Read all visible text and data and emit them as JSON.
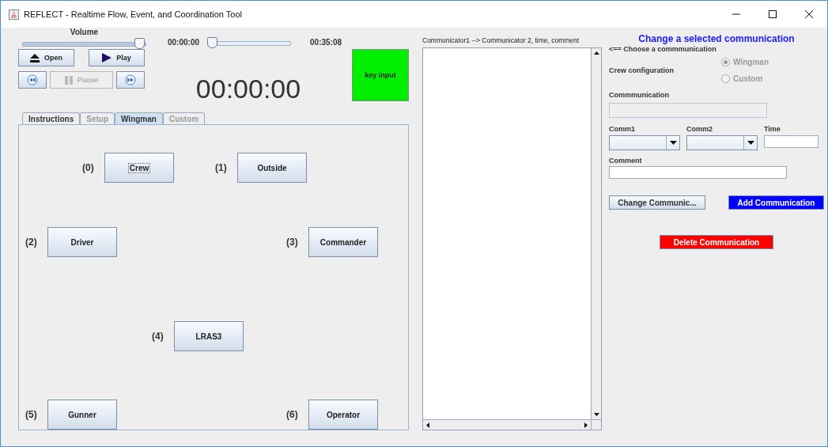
{
  "window": {
    "title": "REFLECT - Realtime Flow, Event, and Coordination Tool"
  },
  "volume": {
    "label": "Volume",
    "level": 0.97
  },
  "playback": {
    "start": "00:00:00",
    "end": "00:35:08",
    "level": 0
  },
  "controls": [
    {
      "kind": "open",
      "label": "Open",
      "disabled": false
    },
    {
      "kind": "play",
      "label": "Play",
      "disabled": false
    },
    {
      "kind": "rewind",
      "disabled": false
    },
    {
      "kind": "pause",
      "label": "Pause",
      "disabled": true
    },
    {
      "kind": "forward",
      "disabled": false
    }
  ],
  "clock": "00:00:00",
  "key_input": "key input",
  "tabs": [
    {
      "label": "Instructions",
      "selected": false,
      "disabled": false
    },
    {
      "label": "Setup",
      "selected": false,
      "disabled": true
    },
    {
      "label": "Wingman",
      "selected": true,
      "disabled": false
    },
    {
      "label": "Custom",
      "selected": false,
      "disabled": true
    }
  ],
  "crew": [
    {
      "index": "(0)",
      "name": "Crew",
      "focused": true
    },
    {
      "index": "(1)",
      "name": "Outside",
      "focused": false
    },
    {
      "index": "(2)",
      "name": "Driver",
      "focused": false
    },
    {
      "index": "(3)",
      "name": "Commander",
      "focused": false
    },
    {
      "index": "(4)",
      "name": "LRAS3",
      "focused": false
    },
    {
      "index": "(5)",
      "name": "Gunner",
      "focused": false
    },
    {
      "index": "(6)",
      "name": "Operator",
      "focused": false
    }
  ],
  "communications": {
    "header": "Communicator1 --> Communicator 2, time, comment"
  },
  "editor": {
    "title": "Change a selected communication",
    "hint": "<== Choose a commmunication",
    "crew_configuration": {
      "label": "Crew configuration",
      "options": [
        {
          "label": "Wingman",
          "selected": true,
          "disabled": true
        },
        {
          "label": "Custom",
          "selected": false,
          "disabled": true
        }
      ]
    },
    "communication": {
      "label": "Commmunication",
      "disabled": true
    },
    "comm1": {
      "label": "Comm1"
    },
    "comm2": {
      "label": "Comm2"
    },
    "time": {
      "label": "Time"
    },
    "comment": {
      "label": "Comment"
    },
    "buttons": [
      {
        "kind": "plain",
        "label": "Change Communic..."
      },
      {
        "kind": "add",
        "label": "Add Communication"
      },
      {
        "kind": "delete",
        "label": "Delete Communication"
      }
    ]
  }
}
